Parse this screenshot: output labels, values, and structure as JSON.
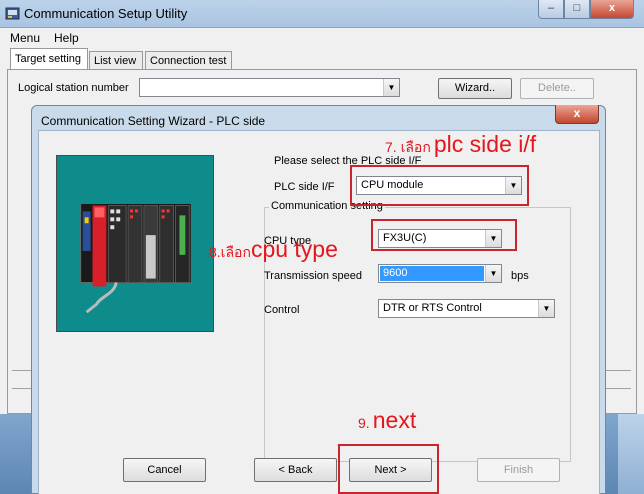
{
  "main_window": {
    "title": "Communication Setup Utility",
    "caption_buttons": {
      "minimize": "–",
      "maximize": "□",
      "close": "x"
    },
    "menu": [
      "Menu",
      "Help"
    ],
    "tabs": [
      {
        "label": "Target setting",
        "active": true
      },
      {
        "label": "List view",
        "active": false
      },
      {
        "label": "Connection test",
        "active": false
      }
    ],
    "logical_station_label": "Logical station number",
    "logical_station_value": "",
    "wizard_button": "Wizard..",
    "delete_button": "Delete.."
  },
  "dialog": {
    "title": "Communication Setting Wizard - PLC side",
    "close": "x",
    "prompt": "Please select the PLC side I/F",
    "plc_side_if": {
      "label": "PLC side I/F",
      "value": "CPU module"
    },
    "group_label": "Communication setting",
    "cpu_type": {
      "label": "CPU type",
      "value": "FX3U(C)"
    },
    "transmission_speed": {
      "label": "Transmission speed",
      "value": "9600",
      "unit": "bps"
    },
    "control": {
      "label": "Control",
      "value": "DTR or RTS Control"
    },
    "buttons": {
      "cancel": "Cancel",
      "back": "< Back",
      "next": "Next >",
      "finish": "Finish"
    }
  },
  "annotations": [
    {
      "number": "7. เลือก",
      "text": "plc side i/f"
    },
    {
      "number": "8.เลือก",
      "text": "cpu type"
    },
    {
      "number": "9.",
      "text": "next"
    }
  ],
  "colors": {
    "annotation_red": "#e5161d",
    "highlight_blue": "#3399ff",
    "plc_image_teal": "#0e8c8c"
  }
}
